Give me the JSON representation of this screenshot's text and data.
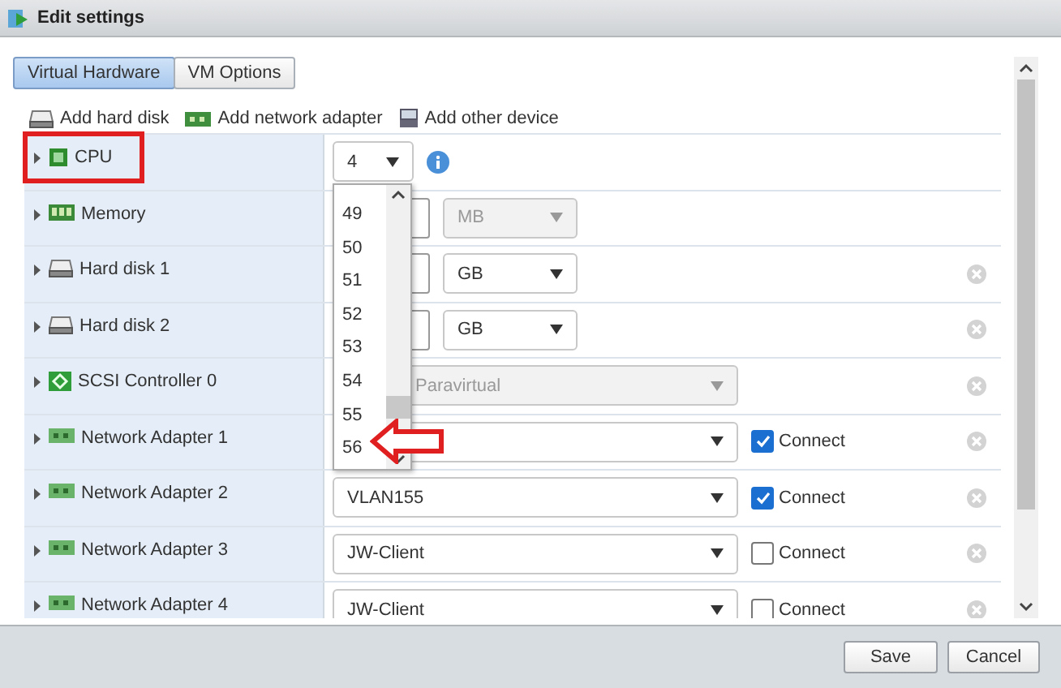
{
  "window": {
    "title": "Edit settings"
  },
  "tabs": [
    {
      "label": "Virtual Hardware",
      "selected": true
    },
    {
      "label": "VM Options",
      "selected": false
    }
  ],
  "toolbar": [
    {
      "label": "Add hard disk",
      "kind": "disk"
    },
    {
      "label": "Add network adapter",
      "kind": "network"
    },
    {
      "label": "Add other device",
      "kind": "device"
    }
  ],
  "devices": [
    {
      "name": "CPU",
      "kind": "cpu",
      "highlighted": true,
      "value": "4",
      "expanded": false
    },
    {
      "name": "Memory",
      "kind": "memory",
      "highlighted": false,
      "unit": "MB",
      "disabled": true,
      "expanded": false
    },
    {
      "name": "Hard disk 1",
      "kind": "disk",
      "highlighted": false,
      "unit": "GB",
      "disabled": false,
      "expanded": false
    },
    {
      "name": "Hard disk 2",
      "kind": "disk",
      "highlighted": false,
      "unit": "GB",
      "disabled": false,
      "expanded": false
    },
    {
      "name": "SCSI Controller 0",
      "kind": "controller",
      "highlighted": false,
      "value": "Paravirtual",
      "disabled": true,
      "expanded": false
    },
    {
      "name": "Network Adapter 1",
      "kind": "network",
      "highlighted": false,
      "connect": {
        "label": "Connect",
        "checked": true
      },
      "expanded": false
    },
    {
      "name": "Network Adapter 2",
      "kind": "network",
      "highlighted": false,
      "value": "VLAN155",
      "connect": {
        "label": "Connect",
        "checked": true
      },
      "expanded": false
    },
    {
      "name": "Network Adapter 3",
      "kind": "network",
      "highlighted": false,
      "value": "JW-Client",
      "connect": {
        "label": "Connect",
        "checked": false
      },
      "expanded": false
    },
    {
      "name": "Network Adapter 4",
      "kind": "network",
      "highlighted": false,
      "value": "JW-Client",
      "connect": {
        "label": "Connect",
        "checked": false
      },
      "expanded": false
    }
  ],
  "cpu_dropdown": {
    "options": [
      "49",
      "50",
      "51",
      "52",
      "53",
      "54",
      "55",
      "56"
    ]
  },
  "buttons": [
    "Save",
    "Cancel"
  ]
}
